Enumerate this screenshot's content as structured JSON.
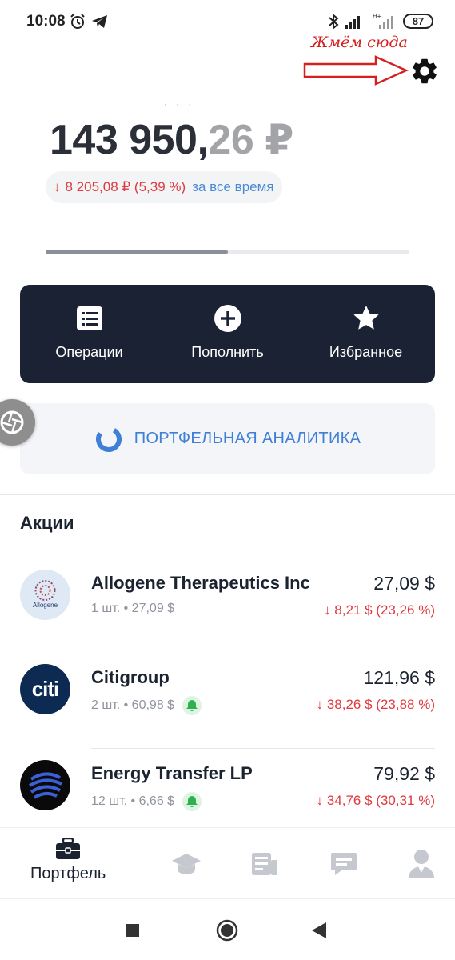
{
  "status_bar": {
    "time": "10:08",
    "battery": "87"
  },
  "annotation": {
    "text": "Жмём сюда"
  },
  "portfolio": {
    "balance_whole": "143 950,",
    "balance_fraction": "26 ₽",
    "change_arrow": "↓",
    "change_value": "8 205,08 ₽ (5,39 %)",
    "change_period": "за все время",
    "progress_fraction": 0.5
  },
  "actions": [
    {
      "label": "Операции",
      "icon": "list-icon"
    },
    {
      "label": "Пополнить",
      "icon": "plus-circle-icon"
    },
    {
      "label": "Избранное",
      "icon": "star-icon"
    }
  ],
  "analytics": {
    "label": "ПОРТФЕЛЬНАЯ АНАЛИТИКА"
  },
  "section": {
    "title": "Акции"
  },
  "stocks": [
    {
      "name": "Allogene Therapeutics Inc",
      "qty": "1 шт. • 27,09 $",
      "price": "27,09 $",
      "change": "↓ 8,21 $ (23,26 %)",
      "logo_text": "Allogene",
      "bell": false
    },
    {
      "name": "Citigroup",
      "qty": "2 шт. • 60,98 $",
      "price": "121,96 $",
      "change": "↓ 38,26 $ (23,88 %)",
      "logo_text": "citi",
      "bell": true
    },
    {
      "name": "Energy Transfer LP",
      "qty": "12 шт. • 6,66 $",
      "price": "79,92 $",
      "change": "↓ 34,76 $ (30,31 %)",
      "bell": true
    }
  ],
  "bottom_nav": {
    "portfolio_label": "Портфель"
  },
  "colors": {
    "accent": "#1a2233",
    "negative": "#e0393e",
    "link": "#4a8ad6",
    "annotation": "#d62020"
  }
}
